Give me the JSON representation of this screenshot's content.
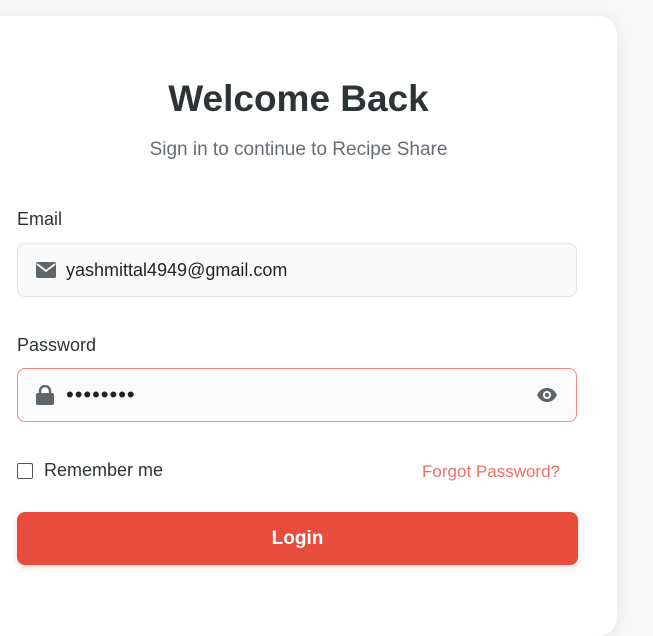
{
  "header": {
    "title": "Welcome Back",
    "subtitle": "Sign in to continue to Recipe Share"
  },
  "form": {
    "email_label": "Email",
    "email_value": "yashmittal4949@gmail.com",
    "email_icon": "envelope-icon",
    "password_label": "Password",
    "password_value": "••••••••",
    "password_icon": "lock-icon",
    "toggle_icon": "eye-icon",
    "remember_label": "Remember me",
    "remember_checked": false,
    "forgot_label": "Forgot Password?",
    "login_label": "Login"
  },
  "colors": {
    "accent": "#e84c3d",
    "link": "#ef6f68",
    "focus_border": "#f08a84"
  }
}
